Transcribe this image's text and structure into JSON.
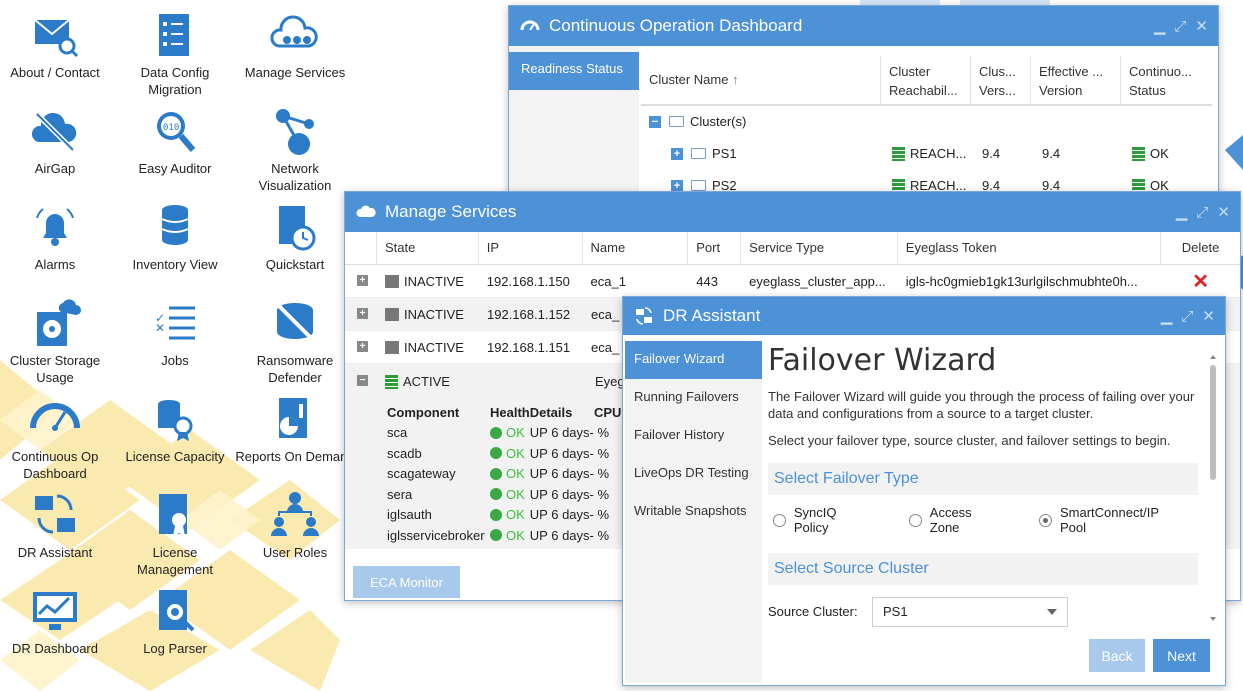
{
  "desktop": {
    "icons": [
      {
        "label": "About / Contact",
        "icon": "mail-search-icon"
      },
      {
        "label": "Data Config Migration",
        "icon": "checklist-icon"
      },
      {
        "label": "Manage Services",
        "icon": "cloud-services-icon"
      },
      {
        "label": "AirGap",
        "icon": "cloud-off-icon"
      },
      {
        "label": "Easy Auditor",
        "icon": "magnifier-binary-icon"
      },
      {
        "label": "Network Visualization",
        "icon": "network-graph-icon"
      },
      {
        "label": "Alarms",
        "icon": "bell-icon"
      },
      {
        "label": "Inventory View",
        "icon": "database-stack-icon"
      },
      {
        "label": "Quickstart",
        "icon": "document-clock-icon"
      },
      {
        "label": "Cluster Storage Usage",
        "icon": "storage-cloud-icon"
      },
      {
        "label": "Jobs",
        "icon": "task-list-icon"
      },
      {
        "label": "Ransomware Defender",
        "icon": "shield-database-icon"
      },
      {
        "label": "Continuous Op Dashboard",
        "icon": "gauge-icon"
      },
      {
        "label": "License Capacity",
        "icon": "database-ribbon-icon"
      },
      {
        "label": "Reports On Demand",
        "icon": "report-pie-icon"
      },
      {
        "label": "DR Assistant",
        "icon": "folder-sync-icon"
      },
      {
        "label": "License Management",
        "icon": "license-document-icon"
      },
      {
        "label": "User Roles",
        "icon": "user-hierarchy-icon"
      },
      {
        "label": "DR Dashboard",
        "icon": "monitor-chart-icon"
      },
      {
        "label": "Log Parser",
        "icon": "document-search-icon"
      }
    ]
  },
  "cod": {
    "title": "Continuous Operation Dashboard",
    "tab": "Readiness Status",
    "columns": [
      "Cluster Name",
      "Cluster Reachabil...",
      "Clus... Vers...",
      "Effective ... Version",
      "Continuo... Status"
    ],
    "sort_arrow": "↑",
    "root": "Cluster(s)",
    "rows": [
      {
        "name": "PS1",
        "reach": "REACH...",
        "ver": "9.4",
        "eff": "9.4",
        "status": "OK"
      },
      {
        "name": "PS2",
        "reach": "REACH...",
        "ver": "9.4",
        "eff": "9.4",
        "status": "OK"
      }
    ]
  },
  "ms": {
    "title": "Manage Services",
    "columns": [
      "State",
      "IP",
      "Name",
      "Port",
      "Service Type",
      "Eyeglass Token",
      "Delete"
    ],
    "rows": [
      {
        "state": "INACTIVE",
        "ip": "192.168.1.150",
        "name": "eca_1",
        "port": "443",
        "type": "eyeglass_cluster_app...",
        "token": "igls-hc0gmieb1gk13urlgilschmubhte0h..."
      },
      {
        "state": "INACTIVE",
        "ip": "192.168.1.152",
        "name": "eca_",
        "port": "",
        "type": "",
        "token": ""
      },
      {
        "state": "INACTIVE",
        "ip": "192.168.1.151",
        "name": "eca_",
        "port": "",
        "type": "",
        "token": ""
      }
    ],
    "active_row": {
      "state": "ACTIVE",
      "name": "Eyeg"
    },
    "comp_headers": [
      "Component",
      "HealthDetails",
      "CPU"
    ],
    "components": [
      {
        "name": "sca",
        "ok": "OK",
        "detail": "UP 6 days- %"
      },
      {
        "name": "scadb",
        "ok": "OK",
        "detail": "UP 6 days- %"
      },
      {
        "name": "scagateway",
        "ok": "OK",
        "detail": "UP 6 days- %"
      },
      {
        "name": "sera",
        "ok": "OK",
        "detail": "UP 6 days- %"
      },
      {
        "name": "iglsauth",
        "ok": "OK",
        "detail": "UP 6 days- %"
      },
      {
        "name": "iglsservicebroker",
        "ok": "OK",
        "detail": "UP 6 days- %"
      }
    ],
    "eca_button": "ECA Monitor"
  },
  "dr": {
    "title": "DR Assistant",
    "nav": [
      "Failover Wizard",
      "Running Failovers",
      "Failover History",
      "LiveOps DR Testing",
      "Writable Snapshots"
    ],
    "heading": "Failover Wizard",
    "intro": "The Failover Wizard will guide you through the process of failing over your data and configurations from a source to a target cluster.",
    "intro2": "Select your failover type, source cluster, and failover settings to begin.",
    "section1": "Select Failover Type",
    "radios": [
      "SyncIQ Policy",
      "Access Zone",
      "SmartConnect/IP Pool"
    ],
    "selected_radio": "SmartConnect/IP Pool",
    "section2": "Select Source Cluster",
    "source_label": "Source Cluster:",
    "source_value": "PS1",
    "back": "Back",
    "next": "Next"
  },
  "colors": {
    "accent": "#4d92d6",
    "ok_green": "#3cbf3c",
    "delete_red": "#e02020"
  }
}
